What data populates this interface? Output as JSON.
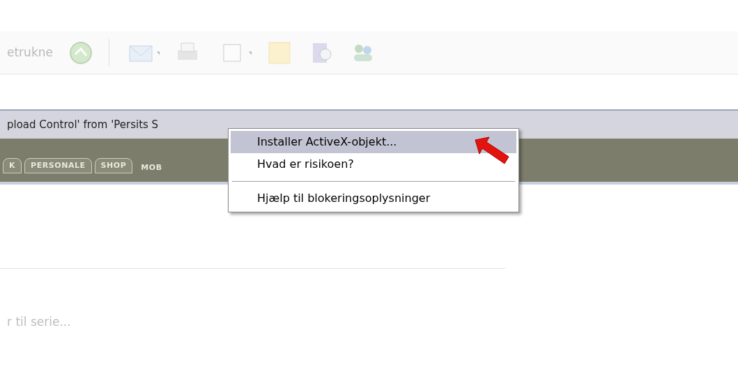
{
  "toolbar": {
    "label": "etrukne"
  },
  "info_bar": {
    "text": "pload Control' from 'Persits S"
  },
  "nav_tabs": [
    {
      "label": "K",
      "kind": "tab"
    },
    {
      "label": "PERSONALE",
      "kind": "tab"
    },
    {
      "label": "SHOP",
      "kind": "tab"
    },
    {
      "label": "MOB",
      "kind": "plain"
    }
  ],
  "context_menu": {
    "items": [
      {
        "kind": "item",
        "label": "Installer ActiveX-objekt...",
        "selected": true
      },
      {
        "kind": "item",
        "label": "Hvad er risikoen?",
        "selected": false
      },
      {
        "kind": "separator"
      },
      {
        "kind": "item",
        "label": "Hjælp til blokeringsoplysninger",
        "selected": false
      }
    ]
  },
  "content": {
    "text": "r til serie..."
  }
}
